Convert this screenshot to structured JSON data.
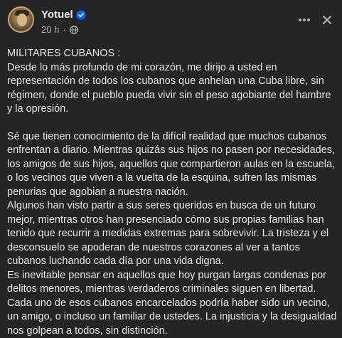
{
  "post": {
    "author": "Yotuel",
    "time": "20 h",
    "dot": "·",
    "paragraphs": [
      "MILITARES CUBANOS :",
      "Desde lo más profundo de mi corazón, me dirijo a usted en representación de todos los cubanos que anhelan una Cuba libre, sin régimen, donde el pueblo pueda vivir sin el peso agobiante del hambre y la opresión.",
      "Sé que tienen conocimiento de la difícil realidad que muchos cubanos enfrentan a diario. Mientras quizás sus hijos no pasen por necesidades, los amigos de sus hijos, aquellos que compartieron aulas en la escuela, o los vecinos que viven a la vuelta de la esquina, sufren las mismas penurias que agobian a nuestra nación.",
      "Algunos han visto partir a sus seres queridos en busca de un futuro mejor, mientras otros han presenciado cómo sus propias familias han tenido que recurrir a medidas extremas para sobrevivir. La tristeza y el desconsuelo se apoderan de nuestros corazones al ver a tantos cubanos luchando cada día por una vida digna.",
      "Es inevitable pensar en aquellos que hoy purgan largas condenas por delitos menores, mientras verdaderos criminales siguen en libertad. Cada uno de esos cubanos encarcelados podría haber sido un vecino, un amigo, o incluso un familiar de ustedes. La injusticia y la desigualdad nos golpean a todos, sin distinción."
    ]
  },
  "icons": {
    "verified": "verified-badge-icon",
    "privacy": "globe-icon",
    "more": "more-horizontal-icon",
    "close": "close-icon"
  },
  "colors": {
    "background": "#242526",
    "text": "#e4e6eb",
    "secondary": "#b0b3b8",
    "verified": "#0866ff"
  }
}
